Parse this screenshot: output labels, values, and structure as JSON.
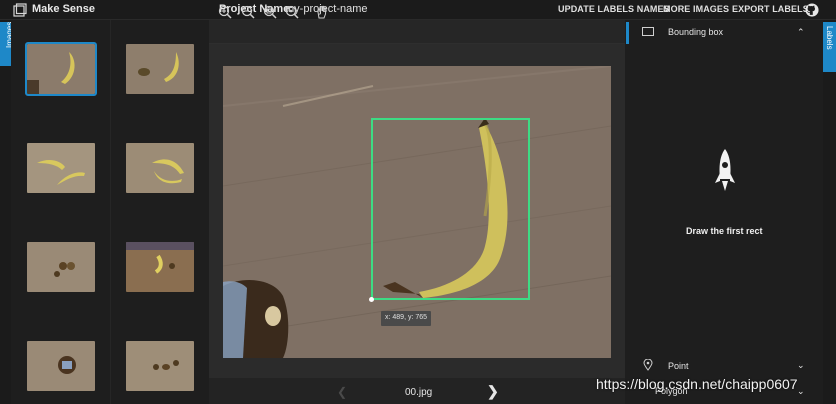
{
  "app": {
    "title": "Make Sense"
  },
  "project": {
    "label": "Project Name:",
    "name": "my-project-name"
  },
  "nav": {
    "update_labels": "UPDATE LABELS NAMES",
    "more_images": "MORE IMAGES",
    "export_labels": "EXPORT LABELS"
  },
  "left_tab": {
    "label": "Images"
  },
  "right_tab": {
    "label": "Labels"
  },
  "thumbnails": {
    "count": 10,
    "selected_index": 0
  },
  "toolbar": {
    "icons": [
      "zoom-in-icon",
      "zoom-out-icon",
      "zoom-fit-icon",
      "zoom-reset-icon",
      "hand-icon"
    ]
  },
  "editor": {
    "cursor_coords": "x: 489, y: 765",
    "filename": "00.jpg"
  },
  "labels_panel": {
    "bounding_box_title": "Bounding box",
    "empty_message": "Draw the first rect",
    "point_title": "Point",
    "polygon_title": "Polygon"
  },
  "watermark": "https://blog.csdn.net/chaipp0607",
  "colors": {
    "accent": "#1e88c8",
    "bbox": "#3ddc84",
    "background": "#171717"
  }
}
